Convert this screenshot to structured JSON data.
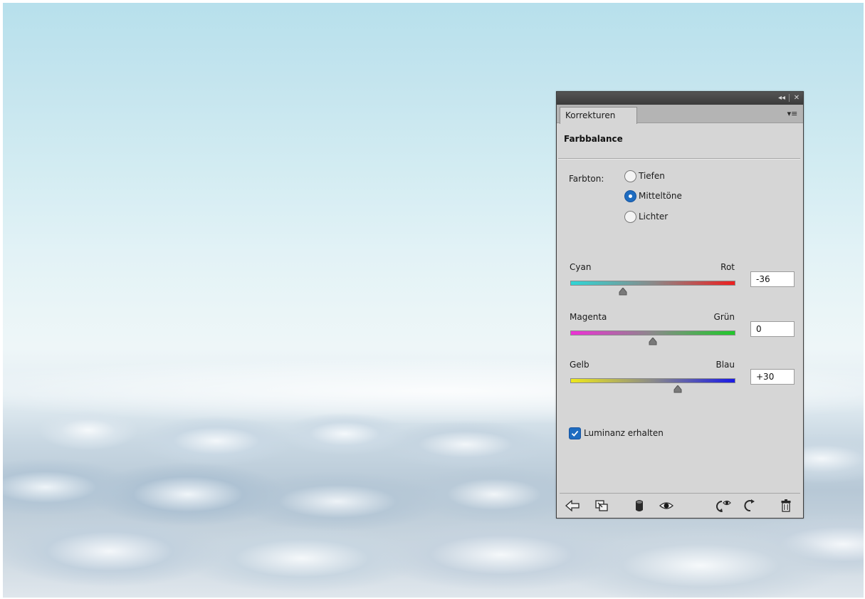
{
  "panel": {
    "tab_label": "Korrekturen",
    "collapse_glyph": "◂◂",
    "close_glyph": "✕",
    "menu_glyph": "▾≡",
    "heading": "Farbbalance"
  },
  "tone": {
    "label": "Farbton:",
    "options": [
      {
        "label": "Tiefen",
        "selected": false
      },
      {
        "label": "Mitteltöne",
        "selected": true
      },
      {
        "label": "Lichter",
        "selected": false
      }
    ]
  },
  "sliders": [
    {
      "left_label": "Cyan",
      "right_label": "Rot",
      "value": "-36",
      "numeric": -36,
      "min": -100,
      "max": 100,
      "colors": [
        "#2fd6d6",
        "#ee1f1f"
      ]
    },
    {
      "left_label": "Magenta",
      "right_label": "Grün",
      "value": "0",
      "numeric": 0,
      "min": -100,
      "max": 100,
      "colors": [
        "#ee2fd6",
        "#20c92a"
      ]
    },
    {
      "left_label": "Gelb",
      "right_label": "Blau",
      "value": "+30",
      "numeric": 30,
      "min": -100,
      "max": 100,
      "colors": [
        "#eee81a",
        "#1a1ae6"
      ]
    }
  ],
  "preserve_luminosity": {
    "label": "Luminanz erhalten",
    "checked": true
  },
  "toolbar": {
    "icons": [
      "back-arrow-icon",
      "clip-to-layer-icon",
      "visibility-mask-icon",
      "eye-icon",
      "view-previous-state-icon",
      "reset-icon",
      "trash-icon"
    ]
  },
  "colors": {
    "accent": "#1e6cc0",
    "panel_bg": "#d6d6d6",
    "titlebar": "#454545"
  }
}
